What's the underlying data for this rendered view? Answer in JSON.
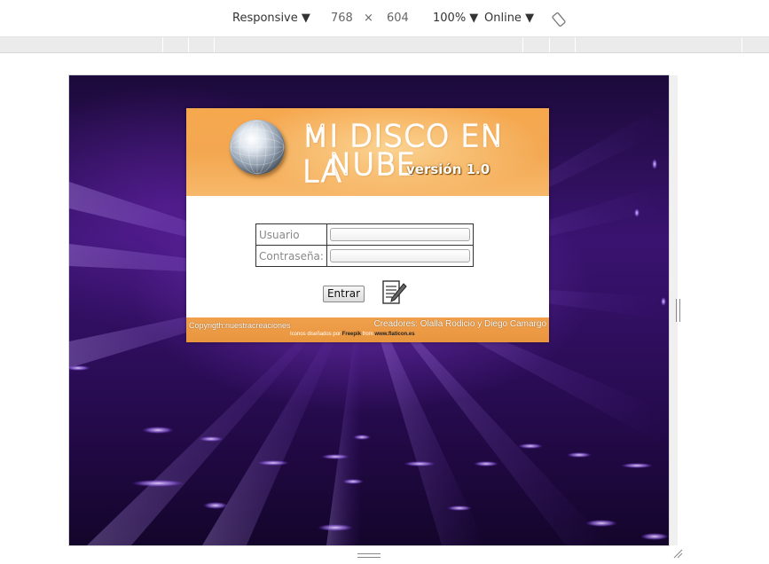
{
  "devtools": {
    "device_label": "Responsive ▼",
    "width": "768",
    "times": "×",
    "height": "604",
    "zoom_label": "100% ▼",
    "network_label": "Online ▼",
    "rotate_icon": "rotate-icon"
  },
  "page": {
    "header": {
      "logo_icon": "disco-ball-icon",
      "title_line1": "MI DISCO EN LA",
      "title_line2": "NUBE",
      "version": "versión 1.0"
    },
    "login": {
      "username_label": "Usuario",
      "username_value": "",
      "password_label": "Contraseña:",
      "password_value": "",
      "submit_label": "Entrar",
      "register_icon": "register-document-icon"
    },
    "footer": {
      "copyright": "Copyrigth:nuestracreaciones",
      "creators": "Creadores: Olalla Rodicio y Diego Camargo",
      "credits_prefix": "Iconos diseñados por",
      "credits_author": "Freepik",
      "credits_middle": "from",
      "credits_site": "www.flaticon.es"
    }
  },
  "colors": {
    "banner_orange": "#f3a750",
    "background_purple": "#3a1370",
    "title_text": "#ffffff"
  }
}
